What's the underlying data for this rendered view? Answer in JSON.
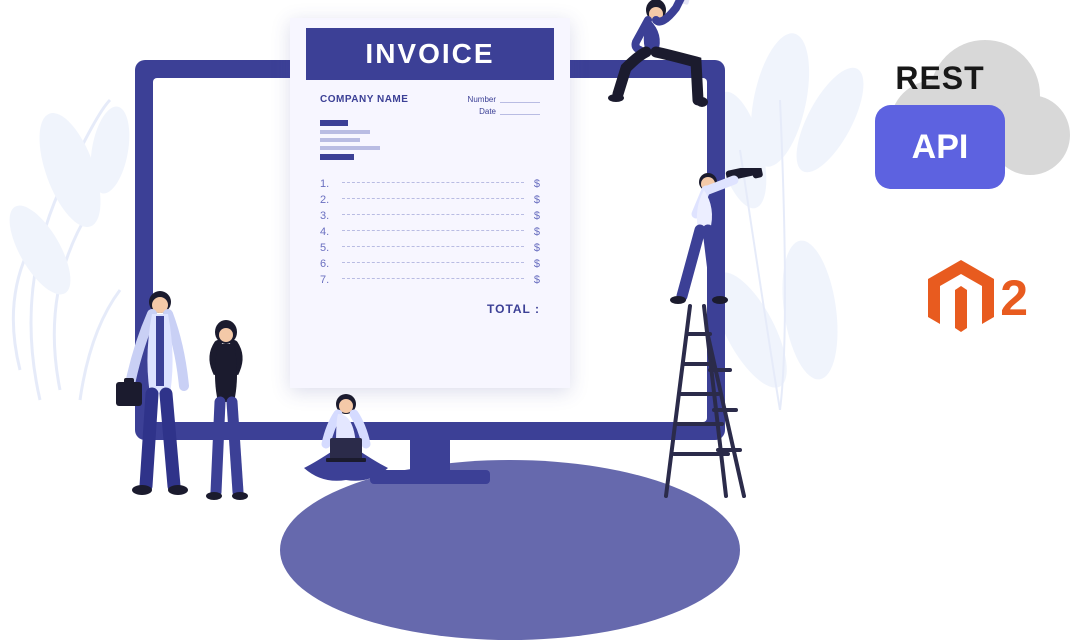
{
  "corner_label": "INVOICE",
  "invoice": {
    "title": "INVOICE",
    "company_label": "COMPANY NAME",
    "number_label": "Number",
    "date_label": "Date",
    "line_numbers": [
      "1.",
      "2.",
      "3.",
      "4.",
      "5.",
      "6.",
      "7."
    ],
    "currency_symbol": "$",
    "total_label": "TOTAL :"
  },
  "logos": {
    "rest_label": "REST",
    "api_label": "API",
    "magento_version": "2"
  }
}
